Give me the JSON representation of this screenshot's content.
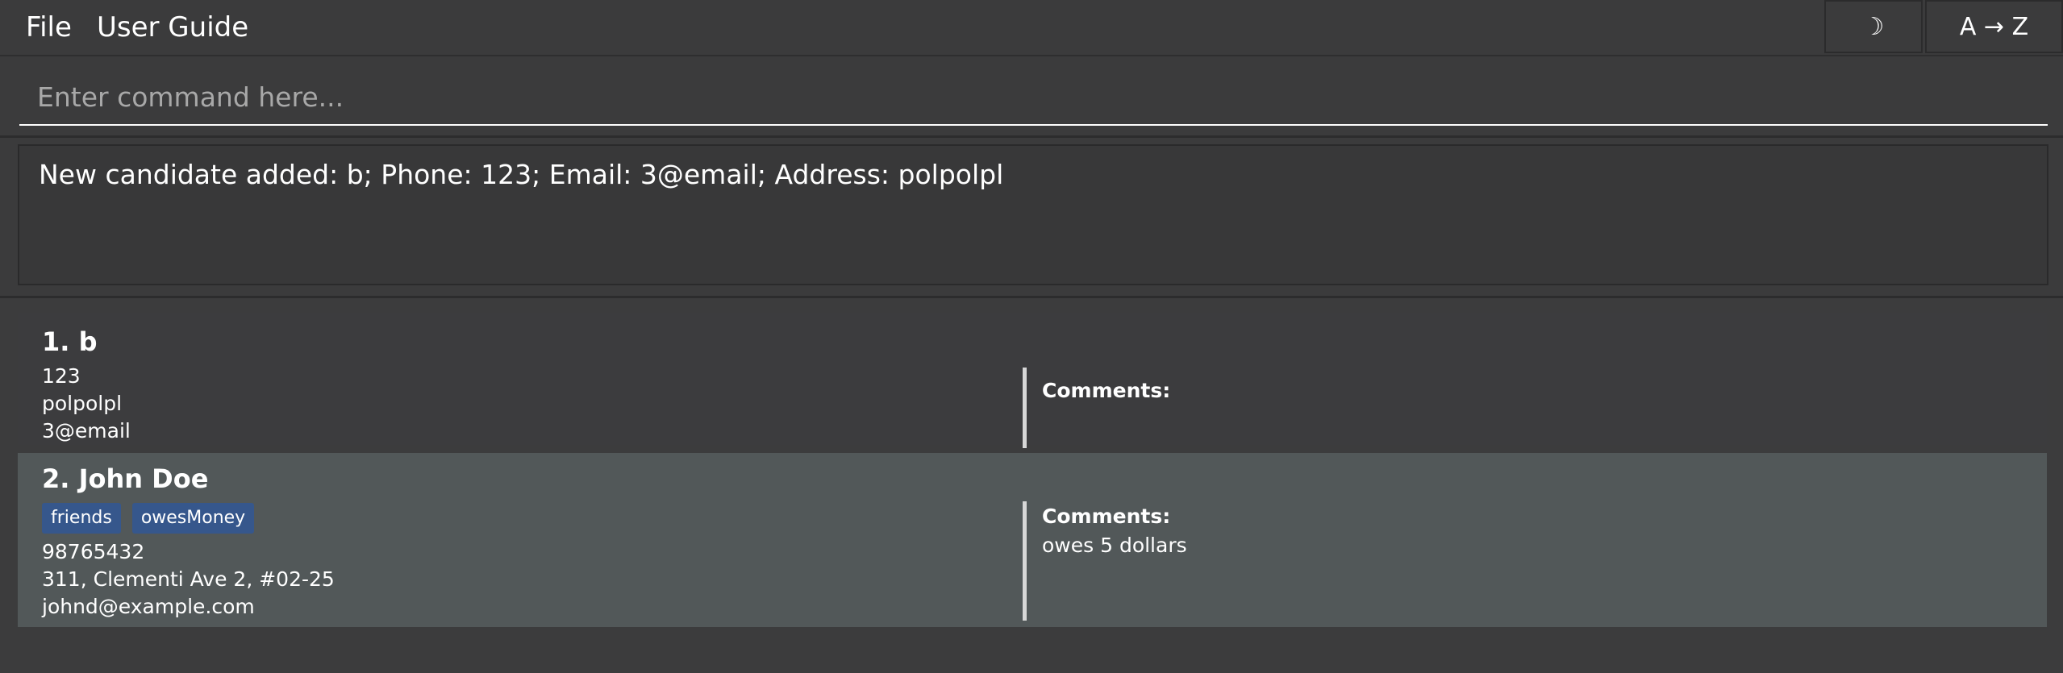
{
  "menu": {
    "file_label": "File",
    "guide_label": "User Guide",
    "theme_icon": "☽",
    "theme_icon_name": "moon-icon",
    "sort_label": "A → Z"
  },
  "command": {
    "placeholder": "Enter command here...",
    "value": ""
  },
  "result": {
    "message": "New candidate added: b; Phone: 123; Email: 3@email; Address: polpolpl"
  },
  "candidates": [
    {
      "name": "1. b",
      "tags": [],
      "phone": "123",
      "address": "polpolpl",
      "email": "3@email",
      "comments_label": "Comments:",
      "comments": ""
    },
    {
      "name": "2. John Doe",
      "tags": [
        "friends",
        "owesMoney"
      ],
      "phone": "98765432",
      "address": "311, Clementi Ave 2, #02-25",
      "email": "johnd@example.com",
      "comments_label": "Comments:",
      "comments": "owes 5 dollars"
    }
  ],
  "colors": {
    "background": "#3c3c3d",
    "selected_card": "#525859",
    "tag": "#36578c"
  }
}
